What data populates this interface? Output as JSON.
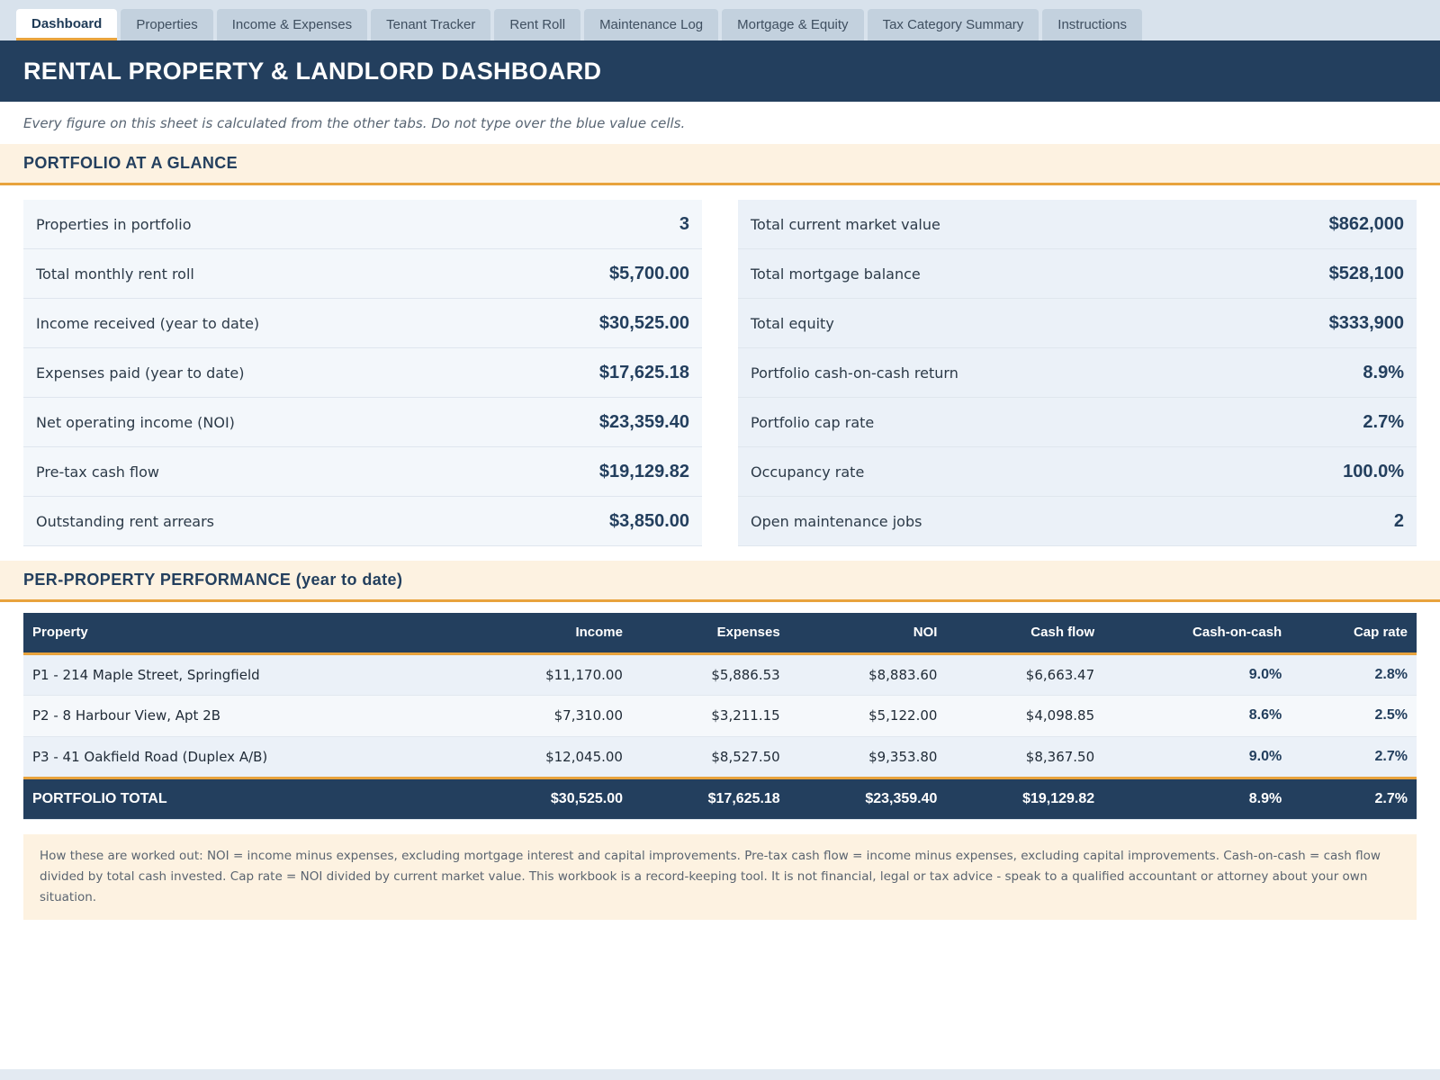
{
  "tabs": [
    {
      "label": "Dashboard",
      "active": true
    },
    {
      "label": "Properties"
    },
    {
      "label": "Income & Expenses"
    },
    {
      "label": "Tenant Tracker"
    },
    {
      "label": "Rent Roll"
    },
    {
      "label": "Maintenance Log"
    },
    {
      "label": "Mortgage & Equity"
    },
    {
      "label": "Tax Category Summary"
    },
    {
      "label": "Instructions"
    }
  ],
  "header": {
    "title": "RENTAL PROPERTY & LANDLORD DASHBOARD",
    "subtitle": "Every figure on this sheet is calculated from the other tabs. Do not type over the blue value cells."
  },
  "glance": {
    "heading": "PORTFOLIO AT A GLANCE",
    "left": [
      {
        "label": "Properties in portfolio",
        "value": "3"
      },
      {
        "label": "Total monthly rent roll",
        "value": "$5,700.00"
      },
      {
        "label": "Income received (year to date)",
        "value": "$30,525.00"
      },
      {
        "label": "Expenses paid (year to date)",
        "value": "$17,625.18"
      },
      {
        "label": "Net operating income (NOI)",
        "value": "$23,359.40"
      },
      {
        "label": "Pre-tax cash flow",
        "value": "$19,129.82"
      },
      {
        "label": "Outstanding rent arrears",
        "value": "$3,850.00"
      }
    ],
    "right": [
      {
        "label": "Total current market value",
        "value": "$862,000"
      },
      {
        "label": "Total mortgage balance",
        "value": "$528,100"
      },
      {
        "label": "Total equity",
        "value": "$333,900"
      },
      {
        "label": "Portfolio cash-on-cash return",
        "value": "8.9%"
      },
      {
        "label": "Portfolio cap rate",
        "value": "2.7%"
      },
      {
        "label": "Occupancy rate",
        "value": "100.0%"
      },
      {
        "label": "Open maintenance jobs",
        "value": "2"
      }
    ]
  },
  "performance": {
    "heading_main": "PER-PROPERTY PERFORMANCE",
    "heading_sub": "(year to date)",
    "columns": [
      "Property",
      "Income",
      "Expenses",
      "NOI",
      "Cash flow",
      "Cash-on-cash",
      "Cap rate"
    ],
    "rows": [
      [
        "P1 - 214 Maple Street, Springfield",
        "$11,170.00",
        "$5,886.53",
        "$8,883.60",
        "$6,663.47",
        "9.0%",
        "2.8%"
      ],
      [
        "P2 - 8 Harbour View, Apt 2B",
        "$7,310.00",
        "$3,211.15",
        "$5,122.00",
        "$4,098.85",
        "8.6%",
        "2.5%"
      ],
      [
        "P3 - 41 Oakfield Road (Duplex A/B)",
        "$12,045.00",
        "$8,527.50",
        "$9,353.80",
        "$8,367.50",
        "9.0%",
        "2.7%"
      ]
    ],
    "total": [
      "PORTFOLIO TOTAL",
      "$30,525.00",
      "$17,625.18",
      "$23,359.40",
      "$19,129.82",
      "8.9%",
      "2.7%"
    ]
  },
  "note": "How these are worked out: NOI = income minus expenses, excluding mortgage interest and capital improvements. Pre-tax cash flow = income minus expenses, excluding capital improvements. Cash-on-cash = cash flow divided by total cash invested. Cap rate = NOI divided by current market value. This workbook is a record-keeping tool. It is not financial, legal or tax advice - speak to a qualified accountant or attorney about your own situation.",
  "colors": {
    "navy": "#233f5e",
    "accent": "#e8a33d",
    "section_bg": "#fdf2e1"
  }
}
